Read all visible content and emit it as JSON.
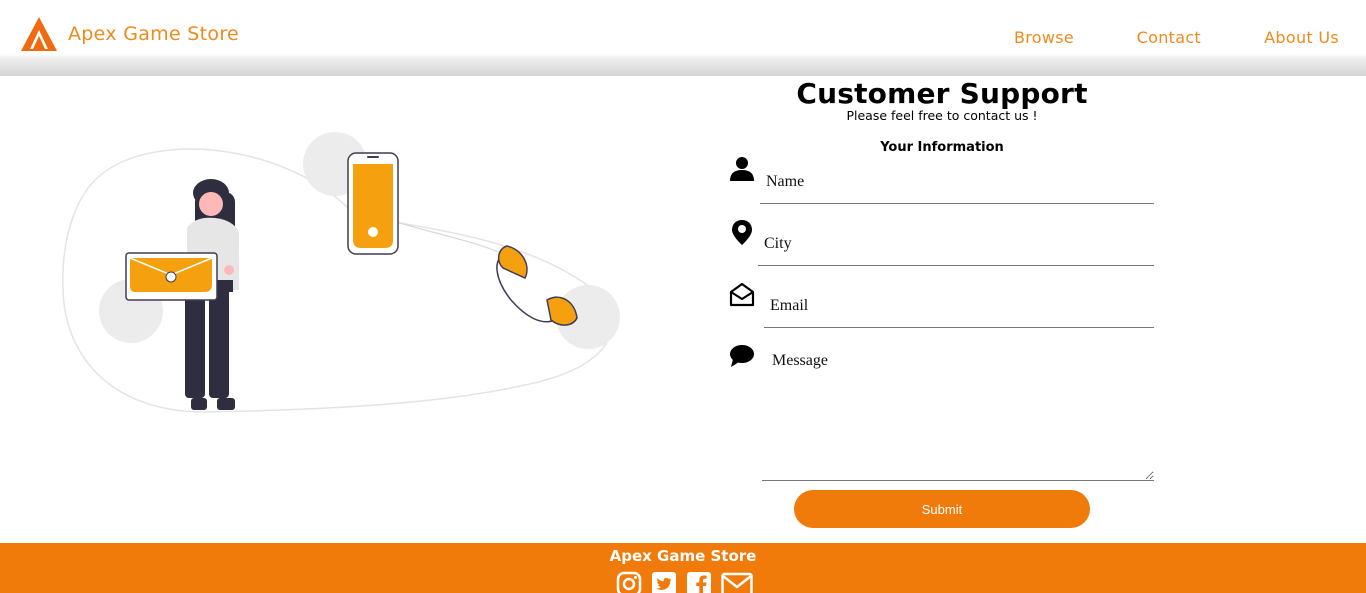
{
  "colors": {
    "accent": "#f07a0a",
    "nav_text": "#ef8a1c",
    "illustration": "#f5a00f"
  },
  "header": {
    "brand_name": "Apex Game Store",
    "nav": [
      "Browse",
      "Contact",
      "About Us"
    ]
  },
  "form": {
    "title": "Customer Support",
    "subtitle": "Please feel free to contact us !",
    "section_label": "Your Information",
    "fields": [
      {
        "icon": "user-icon",
        "placeholder": "Name"
      },
      {
        "icon": "location-pin-icon",
        "placeholder": "City"
      },
      {
        "icon": "envelope-open-icon",
        "placeholder": "Email"
      },
      {
        "icon": "comment-icon",
        "placeholder": "Message"
      }
    ],
    "submit_label": "Submit"
  },
  "footer": {
    "brand_name": "Apex Game Store",
    "social": [
      "instagram-icon",
      "twitter-icon",
      "facebook-icon",
      "envelope-icon"
    ]
  }
}
